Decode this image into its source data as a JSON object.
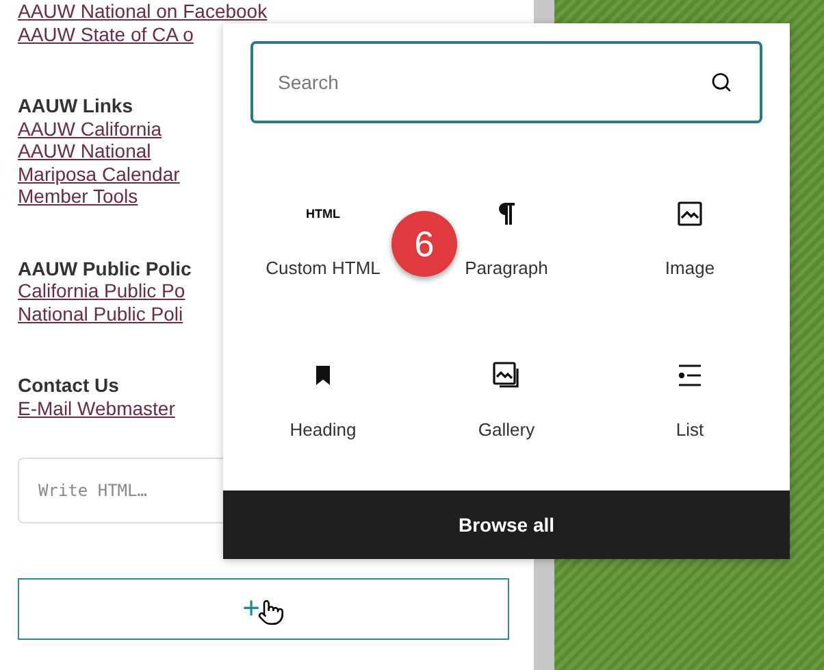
{
  "sidebar": {
    "sections": [
      {
        "links": [
          "AAUW National on Facebook",
          "AAUW State of CA o"
        ]
      },
      {
        "heading": "AAUW Links",
        "links": [
          "AAUW California",
          "AAUW National",
          "Mariposa Calendar",
          "Member Tools"
        ]
      },
      {
        "heading": "AAUW Public Polic",
        "links": [
          "California Public Po",
          "National Public Poli"
        ]
      },
      {
        "heading": "Contact Us",
        "links": [
          "E-Mail Webmaster"
        ]
      }
    ]
  },
  "html_block": {
    "placeholder": "Write HTML…"
  },
  "add_block_button": {
    "label": "+"
  },
  "inserter": {
    "search": {
      "placeholder": "Search"
    },
    "blocks": [
      {
        "kind": "html",
        "icon_text": "HTML",
        "label": "Custom HTML"
      },
      {
        "kind": "paragraph",
        "label": "Paragraph"
      },
      {
        "kind": "image",
        "label": "Image"
      },
      {
        "kind": "heading",
        "label": "Heading"
      },
      {
        "kind": "gallery",
        "label": "Gallery"
      },
      {
        "kind": "list",
        "label": "List"
      }
    ],
    "browse_all": "Browse all"
  },
  "step_badge": "6"
}
